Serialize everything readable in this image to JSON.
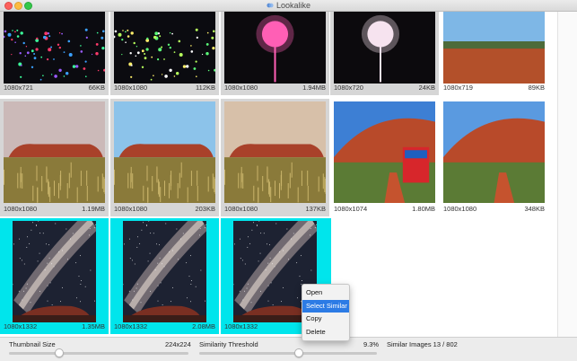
{
  "window": {
    "title": "Lookalike"
  },
  "grid": {
    "rows": [
      [
        {
          "dims": "1080x721",
          "size": "66KB",
          "state": "selected",
          "scene": "lights-field-dark"
        },
        {
          "dims": "1080x1080",
          "size": "112KB",
          "state": "selected",
          "scene": "lights-field-green"
        },
        {
          "dims": "1080x1080",
          "size": "1.94MB",
          "state": "selected",
          "scene": "pink-orb"
        },
        {
          "dims": "1080x720",
          "size": "24KB",
          "state": "selected",
          "scene": "white-orb"
        },
        {
          "dims": "1080x719",
          "size": "89KB",
          "state": "none",
          "scene": "outback-plain"
        }
      ],
      [
        {
          "dims": "1080x1080",
          "size": "1.19MB",
          "state": "selected",
          "scene": "uluru-dusk"
        },
        {
          "dims": "1080x1080",
          "size": "203KB",
          "state": "selected",
          "scene": "uluru-day"
        },
        {
          "dims": "1080x1080",
          "size": "137KB",
          "state": "selected",
          "scene": "uluru-sunset"
        },
        {
          "dims": "1080x1074",
          "size": "1.80MB",
          "state": "none",
          "scene": "uluru-sign"
        },
        {
          "dims": "1080x1080",
          "size": "348KB",
          "state": "none",
          "scene": "uluru-trees"
        }
      ],
      [
        {
          "dims": "1080x1332",
          "size": "1.35MB",
          "state": "similar",
          "scene": "milky-way"
        },
        {
          "dims": "1080x1332",
          "size": "2.08MB",
          "state": "similar",
          "scene": "milky-way"
        },
        {
          "dims": "1080x1332",
          "size": "",
          "state": "similar",
          "scene": "milky-way"
        }
      ]
    ]
  },
  "context_menu": {
    "items": [
      {
        "label": "Open",
        "active": false
      },
      {
        "label": "Select Similar",
        "active": true
      },
      {
        "label": "Copy",
        "active": false
      },
      {
        "label": "Delete",
        "active": false
      }
    ]
  },
  "bottom_bar": {
    "thumbnail_size_label": "Thumbnail Size",
    "thumbnail_size_value": "224x224",
    "thumbnail_slider_level": 0.28,
    "similarity_label": "Similarity Threshold",
    "similarity_value": "9.3%",
    "similarity_slider_level": 0.56,
    "similar_images_text": "Similar Images 13 / 802"
  },
  "colors": {
    "selected_bg": "#d6d6d6",
    "similar_bg": "#00e5ec",
    "menu_highlight": "#2c7be5"
  }
}
